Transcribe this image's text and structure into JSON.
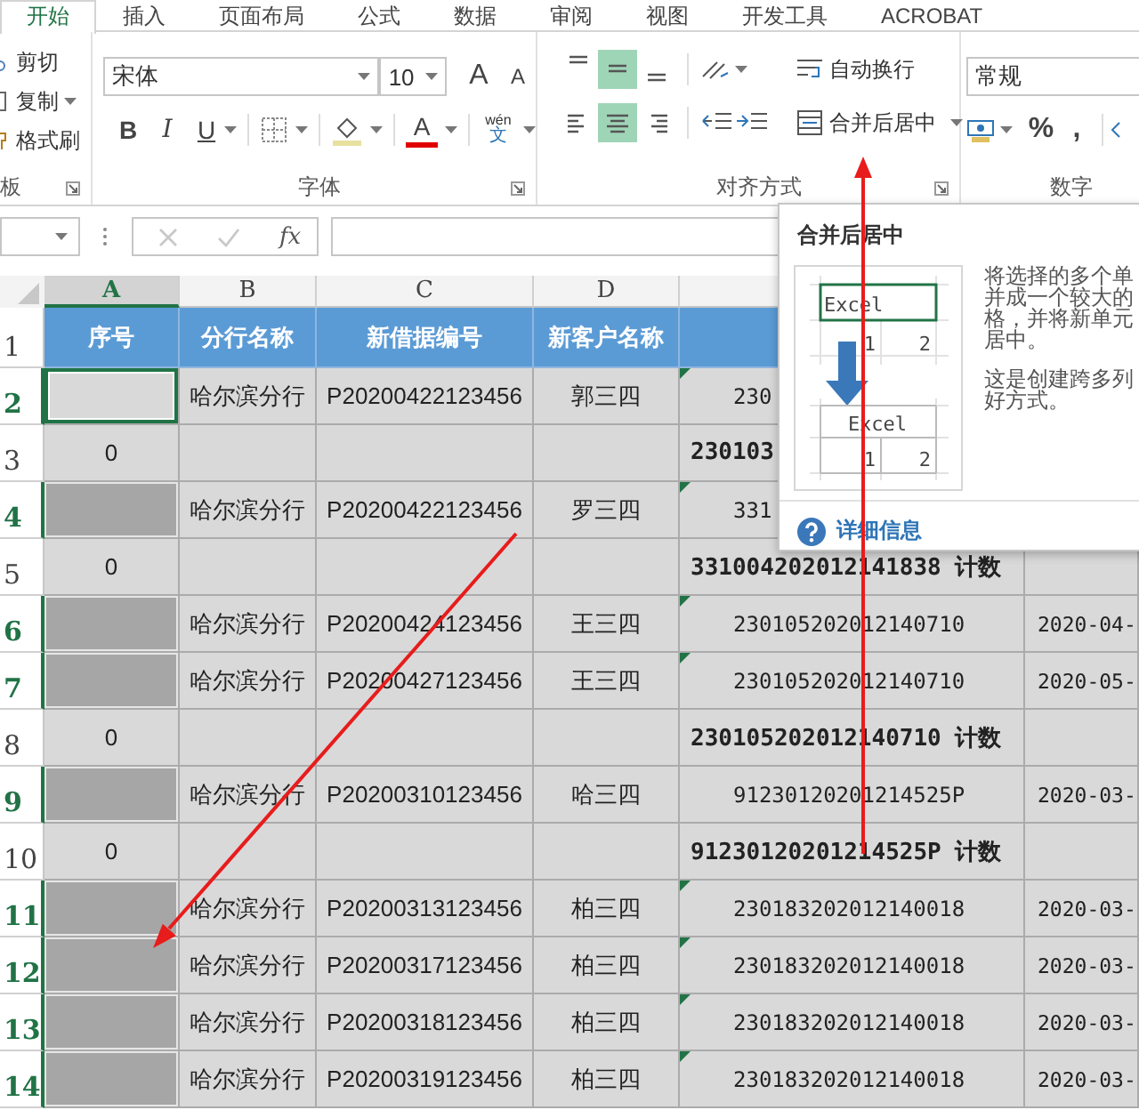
{
  "ribbon_tabs": [
    {
      "label": "开始",
      "selected": true
    },
    {
      "label": "插入",
      "selected": false
    },
    {
      "label": "页面布局",
      "selected": false
    },
    {
      "label": "公式",
      "selected": false
    },
    {
      "label": "数据",
      "selected": false
    },
    {
      "label": "审阅",
      "selected": false
    },
    {
      "label": "视图",
      "selected": false
    },
    {
      "label": "开发工具",
      "selected": false
    },
    {
      "label": "ACROBAT",
      "selected": false
    }
  ],
  "clipboard": {
    "cut": "剪切",
    "copy": "复制",
    "format_painter": "格式刷",
    "group_label": "板"
  },
  "font": {
    "name": "宋体",
    "size": "10",
    "grow": "A",
    "shrink": "A",
    "bold": "B",
    "italic": "I",
    "underline": "U",
    "font_color": "A",
    "phonetic": "wén",
    "phonetic_char": "文",
    "group_label": "字体"
  },
  "alignment": {
    "vertical": [
      {
        "selected": false
      },
      {
        "selected": true
      },
      {
        "selected": false
      }
    ],
    "horizontal": [
      {
        "selected": false
      },
      {
        "selected": true
      },
      {
        "selected": false
      }
    ],
    "wrap_text": "自动换行",
    "merge_center": "合并后居中",
    "group_label": "对齐方式"
  },
  "number": {
    "format": "常规",
    "percent": "%",
    "comma": ",",
    "group_label": "数字"
  },
  "formula_bar": {
    "function_label": "fx"
  },
  "sheet": {
    "columns": [
      {
        "label": "A",
        "selected": true
      },
      {
        "label": "B",
        "selected": false
      },
      {
        "label": "C",
        "selected": false
      },
      {
        "label": "D",
        "selected": false
      }
    ],
    "header_row": {
      "number": "1",
      "titles": [
        "序号",
        "分行名称",
        "新借据编号",
        "新客户名称"
      ]
    },
    "rows": [
      {
        "number": "2",
        "kind": "detail",
        "selected": true,
        "active": true,
        "flagged": true,
        "branch": "哈尔滨分行",
        "loan_no": "P20200422123456",
        "customer": "郭三四",
        "column_5": "230"
      },
      {
        "number": "3",
        "kind": "subtotal",
        "selected": false,
        "active": false,
        "flagged": false,
        "serial": "0",
        "column_5": "230103"
      },
      {
        "number": "4",
        "kind": "detail",
        "selected": true,
        "active": false,
        "flagged": true,
        "branch": "哈尔滨分行",
        "loan_no": "P20200422123456",
        "customer": "罗三四",
        "column_5": "331"
      },
      {
        "number": "5",
        "kind": "subtotal",
        "selected": false,
        "active": false,
        "flagged": false,
        "serial": "0",
        "column_5": "331004202012141838 计数"
      },
      {
        "number": "6",
        "kind": "detail",
        "selected": true,
        "active": false,
        "flagged": true,
        "branch": "哈尔滨分行",
        "loan_no": "P20200424123456",
        "customer": "王三四",
        "column_5": "230105202012140710",
        "column_6": "2020-04-"
      },
      {
        "number": "7",
        "kind": "detail",
        "selected": true,
        "active": false,
        "flagged": true,
        "branch": "哈尔滨分行",
        "loan_no": "P20200427123456",
        "customer": "王三四",
        "column_5": "230105202012140710",
        "column_6": "2020-05-"
      },
      {
        "number": "8",
        "kind": "subtotal",
        "selected": false,
        "active": false,
        "flagged": false,
        "serial": "0",
        "column_5": "230105202012140710 计数"
      },
      {
        "number": "9",
        "kind": "detail",
        "selected": true,
        "active": false,
        "flagged": false,
        "branch": "哈尔滨分行",
        "loan_no": "P20200310123456",
        "customer": "哈三四",
        "column_5": "91230120201214525P",
        "column_6": "2020-03-"
      },
      {
        "number": "10",
        "kind": "subtotal",
        "selected": false,
        "active": false,
        "flagged": false,
        "serial": "0",
        "column_5": "91230120201214525P 计数"
      },
      {
        "number": "11",
        "kind": "detail",
        "selected": true,
        "active": false,
        "flagged": true,
        "branch": "哈尔滨分行",
        "loan_no": "P20200313123456",
        "customer": "柏三四",
        "column_5": "230183202012140018",
        "column_6": "2020-03-"
      },
      {
        "number": "12",
        "kind": "detail",
        "selected": true,
        "active": false,
        "flagged": true,
        "branch": "哈尔滨分行",
        "loan_no": "P20200317123456",
        "customer": "柏三四",
        "column_5": "230183202012140018",
        "column_6": "2020-03-"
      },
      {
        "number": "13",
        "kind": "detail",
        "selected": true,
        "active": false,
        "flagged": true,
        "branch": "哈尔滨分行",
        "loan_no": "P20200318123456",
        "customer": "柏三四",
        "column_5": "230183202012140018",
        "column_6": "2020-03-"
      },
      {
        "number": "14",
        "kind": "detail",
        "selected": true,
        "active": false,
        "flagged": true,
        "branch": "哈尔滨分行",
        "loan_no": "P20200319123456",
        "customer": "柏三四",
        "column_5": "230183202012140018",
        "column_6": "2020-03-"
      }
    ]
  },
  "tooltip": {
    "title": "合并后居中",
    "illustration": {
      "before": [
        "Excel",
        "1",
        "2"
      ],
      "after": [
        "Excel",
        "1",
        "2"
      ]
    },
    "paragraphs": [
      [
        "将选择的多个单",
        "并成一个较大的",
        "格，并将新单元",
        "居中。"
      ],
      [
        "这是创建跨多列",
        "好方式。"
      ]
    ],
    "link": "详细信息"
  }
}
